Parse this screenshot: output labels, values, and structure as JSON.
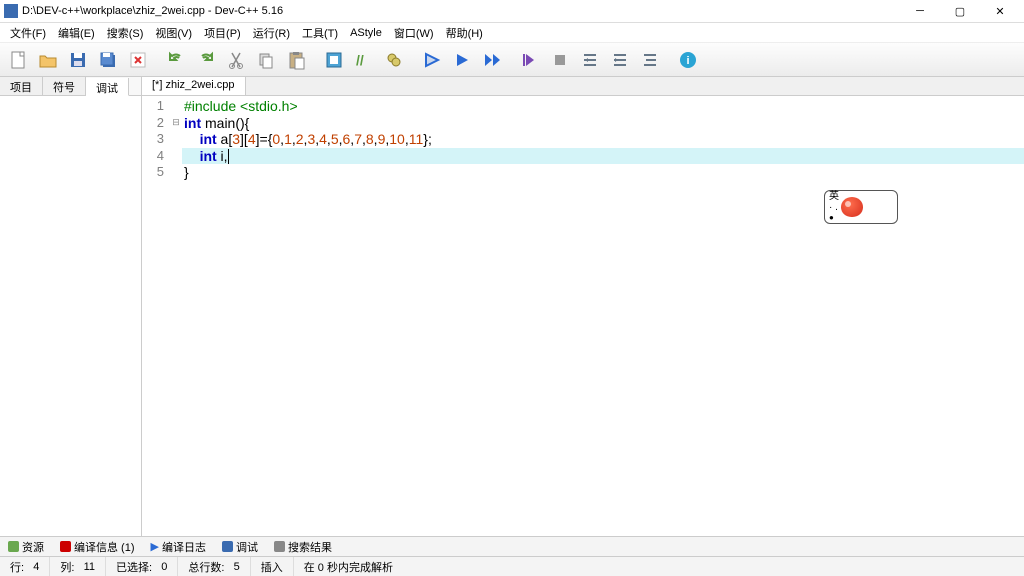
{
  "titlebar": {
    "path": "D:\\DEV-c++\\workplace\\zhiz_2wei.cpp - Dev-C++ 5.16"
  },
  "menubar": [
    "文件(F)",
    "编辑(E)",
    "搜索(S)",
    "视图(V)",
    "项目(P)",
    "运行(R)",
    "工具(T)",
    "AStyle",
    "窗口(W)",
    "帮助(H)"
  ],
  "sidetabs": [
    "项目",
    "符号",
    "调试"
  ],
  "filetab": "[*] zhiz_2wei.cpp",
  "code": {
    "lines": [
      {
        "n": 1,
        "html": "<span class='pp'>#include &lt;stdio.h&gt;</span>"
      },
      {
        "n": 2,
        "fold": "⊟",
        "html": "<span class='kw'>int</span> main(){"
      },
      {
        "n": 3,
        "html": "    <span class='kw'>int</span> a[<span class='num'>3</span>][<span class='num'>4</span>]={<span class='num'>0</span>,<span class='num'>1</span>,<span class='num'>2</span>,<span class='num'>3</span>,<span class='num'>4</span>,<span class='num'>5</span>,<span class='num'>6</span>,<span class='num'>7</span>,<span class='num'>8</span>,<span class='num'>9</span>,<span class='num'>10</span>,<span class='num'>11</span>};"
      },
      {
        "n": 4,
        "current": true,
        "html": "    <span class='kw'>int</span> i,<span class='cursor'></span>"
      },
      {
        "n": 5,
        "html": "}"
      }
    ]
  },
  "ime": {
    "ch": "英",
    "dots": "· .",
    "mick": "●"
  },
  "bottomtabs": [
    {
      "icon": "#6aa84f",
      "label": "资源"
    },
    {
      "icon": "#c00",
      "label": "编译信息 (1)"
    },
    {
      "play": true,
      "label": "编译日志"
    },
    {
      "icon": "#3a6bb0",
      "label": "调试"
    },
    {
      "icon": "#888",
      "label": "搜索结果"
    }
  ],
  "status": {
    "line_label": "行:",
    "line": "4",
    "col_label": "列:",
    "col": "11",
    "sel_label": "已选择:",
    "sel": "0",
    "total_label": "总行数:",
    "total": "5",
    "mode": "插入",
    "parse": "在 0 秒内完成解析"
  }
}
